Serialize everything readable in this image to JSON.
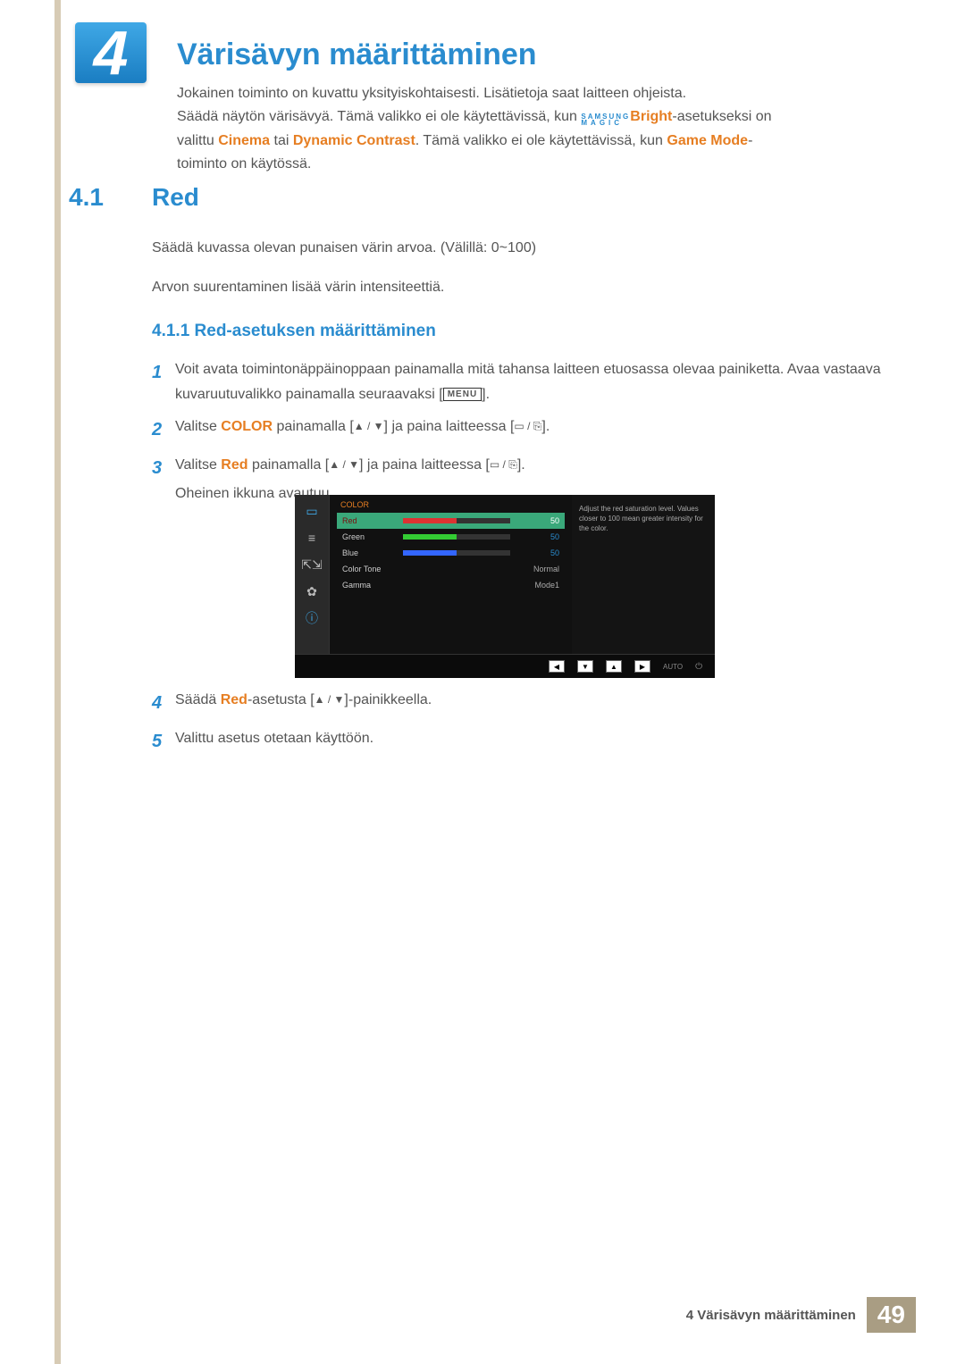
{
  "chapter": {
    "num": "4",
    "title": "Värisävyn määrittäminen"
  },
  "intro": {
    "l1": "Jokainen toiminto on kuvattu yksityiskohtaisesti. Lisätietoja saat laitteen ohjeista.",
    "l2a": "Säädä näytön värisävyä. Tämä valikko ei ole käytettävissä, kun ",
    "magic_top": "SAMSUNG",
    "magic_bot": "MAGIC",
    "bright": "Bright",
    "l2b": "-asetukseksi on",
    "l3a": "valittu ",
    "cinema": "Cinema",
    "or": " tai ",
    "dyn": "Dynamic Contrast",
    "l3b": ". Tämä valikko ei ole käytettävissä, kun ",
    "game": "Game Mode",
    "l3c": "-",
    "l4": "toiminto on käytössä."
  },
  "section": {
    "num": "4.1",
    "title": "Red"
  },
  "body": {
    "p1": "Säädä kuvassa olevan punaisen värin arvoa. (Välillä: 0~100)",
    "p2": "Arvon suurentaminen lisää värin intensiteettiä."
  },
  "subsection": {
    "num_title": "4.1.1 Red-asetuksen määrittäminen"
  },
  "steps": [
    {
      "n": "1",
      "ta": "Voit avata toimintonäppäinoppaan painamalla mitä tahansa laitteen etuosassa olevaa painiketta. Avaa vastaava kuvaruutuvalikko painamalla seuraavaksi [",
      "menu": "MENU",
      "tb": "]."
    },
    {
      "n": "2",
      "ta": "Valitse ",
      "kw": "COLOR",
      "tb": " painamalla [",
      "ar": "▲ / ▼",
      "tc": "] ja paina laitteessa [",
      "ic": "▭ / ⎘",
      "td": "]."
    },
    {
      "n": "3",
      "ta": "Valitse ",
      "kw": "Red",
      "tb": " painamalla [",
      "ar": "▲ / ▼",
      "tc": "] ja paina laitteessa [",
      "ic": "▭ / ⎘",
      "td": "].",
      "te": "Oheinen ikkuna avautuu."
    }
  ],
  "steps_after": [
    {
      "n": "4",
      "ta": "Säädä ",
      "kw": "Red",
      "tb": "-asetusta [",
      "ar": "▲ / ▼",
      "tc": "]-painikkeella."
    },
    {
      "n": "5",
      "ta": "Valittu asetus otetaan käyttöön."
    }
  ],
  "osd": {
    "title": "COLOR",
    "rows": {
      "red": {
        "label": "Red",
        "val": "50"
      },
      "green": {
        "label": "Green",
        "val": "50"
      },
      "blue": {
        "label": "Blue",
        "val": "50"
      },
      "tone": {
        "label": "Color Tone",
        "val": "Normal"
      },
      "gamma": {
        "label": "Gamma",
        "val": "Mode1"
      }
    },
    "help": "Adjust the red saturation level. Values closer to 100 mean greater intensity for the color.",
    "footer_auto": "AUTO"
  },
  "footer": {
    "text": "4 Värisävyn määrittäminen",
    "page": "49"
  }
}
